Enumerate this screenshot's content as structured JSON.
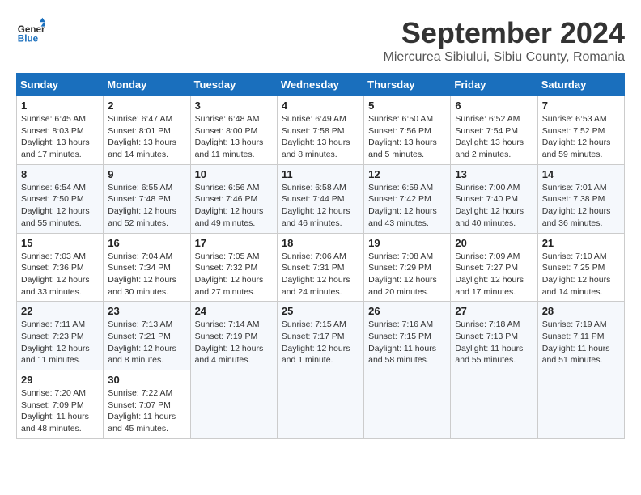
{
  "header": {
    "logo_line1": "General",
    "logo_line2": "Blue",
    "month": "September 2024",
    "location": "Miercurea Sibiului, Sibiu County, Romania"
  },
  "weekdays": [
    "Sunday",
    "Monday",
    "Tuesday",
    "Wednesday",
    "Thursday",
    "Friday",
    "Saturday"
  ],
  "weeks": [
    [
      {
        "day": "1",
        "sunrise": "6:45 AM",
        "sunset": "8:03 PM",
        "daylight": "13 hours and 17 minutes."
      },
      {
        "day": "2",
        "sunrise": "6:47 AM",
        "sunset": "8:01 PM",
        "daylight": "13 hours and 14 minutes."
      },
      {
        "day": "3",
        "sunrise": "6:48 AM",
        "sunset": "8:00 PM",
        "daylight": "13 hours and 11 minutes."
      },
      {
        "day": "4",
        "sunrise": "6:49 AM",
        "sunset": "7:58 PM",
        "daylight": "13 hours and 8 minutes."
      },
      {
        "day": "5",
        "sunrise": "6:50 AM",
        "sunset": "7:56 PM",
        "daylight": "13 hours and 5 minutes."
      },
      {
        "day": "6",
        "sunrise": "6:52 AM",
        "sunset": "7:54 PM",
        "daylight": "13 hours and 2 minutes."
      },
      {
        "day": "7",
        "sunrise": "6:53 AM",
        "sunset": "7:52 PM",
        "daylight": "12 hours and 59 minutes."
      }
    ],
    [
      {
        "day": "8",
        "sunrise": "6:54 AM",
        "sunset": "7:50 PM",
        "daylight": "12 hours and 55 minutes."
      },
      {
        "day": "9",
        "sunrise": "6:55 AM",
        "sunset": "7:48 PM",
        "daylight": "12 hours and 52 minutes."
      },
      {
        "day": "10",
        "sunrise": "6:56 AM",
        "sunset": "7:46 PM",
        "daylight": "12 hours and 49 minutes."
      },
      {
        "day": "11",
        "sunrise": "6:58 AM",
        "sunset": "7:44 PM",
        "daylight": "12 hours and 46 minutes."
      },
      {
        "day": "12",
        "sunrise": "6:59 AM",
        "sunset": "7:42 PM",
        "daylight": "12 hours and 43 minutes."
      },
      {
        "day": "13",
        "sunrise": "7:00 AM",
        "sunset": "7:40 PM",
        "daylight": "12 hours and 40 minutes."
      },
      {
        "day": "14",
        "sunrise": "7:01 AM",
        "sunset": "7:38 PM",
        "daylight": "12 hours and 36 minutes."
      }
    ],
    [
      {
        "day": "15",
        "sunrise": "7:03 AM",
        "sunset": "7:36 PM",
        "daylight": "12 hours and 33 minutes."
      },
      {
        "day": "16",
        "sunrise": "7:04 AM",
        "sunset": "7:34 PM",
        "daylight": "12 hours and 30 minutes."
      },
      {
        "day": "17",
        "sunrise": "7:05 AM",
        "sunset": "7:32 PM",
        "daylight": "12 hours and 27 minutes."
      },
      {
        "day": "18",
        "sunrise": "7:06 AM",
        "sunset": "7:31 PM",
        "daylight": "12 hours and 24 minutes."
      },
      {
        "day": "19",
        "sunrise": "7:08 AM",
        "sunset": "7:29 PM",
        "daylight": "12 hours and 20 minutes."
      },
      {
        "day": "20",
        "sunrise": "7:09 AM",
        "sunset": "7:27 PM",
        "daylight": "12 hours and 17 minutes."
      },
      {
        "day": "21",
        "sunrise": "7:10 AM",
        "sunset": "7:25 PM",
        "daylight": "12 hours and 14 minutes."
      }
    ],
    [
      {
        "day": "22",
        "sunrise": "7:11 AM",
        "sunset": "7:23 PM",
        "daylight": "12 hours and 11 minutes."
      },
      {
        "day": "23",
        "sunrise": "7:13 AM",
        "sunset": "7:21 PM",
        "daylight": "12 hours and 8 minutes."
      },
      {
        "day": "24",
        "sunrise": "7:14 AM",
        "sunset": "7:19 PM",
        "daylight": "12 hours and 4 minutes."
      },
      {
        "day": "25",
        "sunrise": "7:15 AM",
        "sunset": "7:17 PM",
        "daylight": "12 hours and 1 minute."
      },
      {
        "day": "26",
        "sunrise": "7:16 AM",
        "sunset": "7:15 PM",
        "daylight": "11 hours and 58 minutes."
      },
      {
        "day": "27",
        "sunrise": "7:18 AM",
        "sunset": "7:13 PM",
        "daylight": "11 hours and 55 minutes."
      },
      {
        "day": "28",
        "sunrise": "7:19 AM",
        "sunset": "7:11 PM",
        "daylight": "11 hours and 51 minutes."
      }
    ],
    [
      {
        "day": "29",
        "sunrise": "7:20 AM",
        "sunset": "7:09 PM",
        "daylight": "11 hours and 48 minutes."
      },
      {
        "day": "30",
        "sunrise": "7:22 AM",
        "sunset": "7:07 PM",
        "daylight": "11 hours and 45 minutes."
      },
      null,
      null,
      null,
      null,
      null
    ]
  ]
}
